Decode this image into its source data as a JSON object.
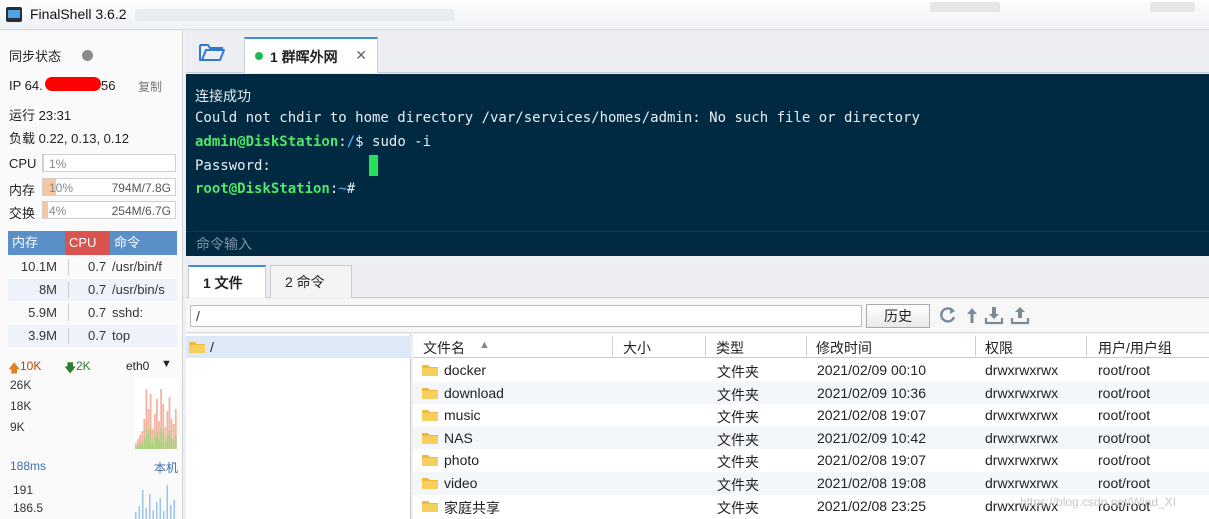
{
  "window": {
    "title": "FinalShell 3.6.2"
  },
  "left": {
    "sync_label": "同步状态",
    "ip_prefix": "IP 64.",
    "ip_suffix": "56",
    "copy_label": "复制",
    "uptime": "运行 23:31",
    "load": "负载 0.22, 0.13, 0.12",
    "cpu": {
      "label": "CPU",
      "pct": "1%",
      "fill": 1
    },
    "mem": {
      "label": "内存",
      "pct": "10%",
      "amount": "794M/7.8G",
      "fill": 10
    },
    "swap": {
      "label": "交换",
      "pct": "4%",
      "amount": "254M/6.7G",
      "fill": 4
    },
    "proc_headers": [
      "内存",
      "CPU",
      "命令"
    ],
    "processes": [
      {
        "mem": "10.1M",
        "cpu": "0.7",
        "cmd": "/usr/bin/f"
      },
      {
        "mem": "8M",
        "cpu": "0.7",
        "cmd": "/usr/bin/s"
      },
      {
        "mem": "5.9M",
        "cpu": "0.7",
        "cmd": "sshd:"
      },
      {
        "mem": "3.9M",
        "cpu": "0.7",
        "cmd": "top"
      }
    ],
    "net": {
      "up": "10K",
      "down": "2K",
      "iface": "eth0",
      "ticks": [
        "26K",
        "18K",
        "9K"
      ]
    },
    "ping": {
      "latency": "188ms",
      "target": "本机",
      "ticks": [
        "191",
        "186.5"
      ]
    }
  },
  "tabs": {
    "session": "1 群晖外网"
  },
  "terminal": {
    "line1": "连接成功",
    "line2": "Could not chdir to home directory /var/services/homes/admin: No such file or directory",
    "prompt1_user": "admin@DiskStation",
    "prompt1_sep": ":",
    "prompt1_path": "/",
    "prompt1_cmd": "$ sudo -i",
    "line4": "Password:",
    "prompt2_user": "root@DiskStation",
    "prompt2_sep": ":",
    "prompt2_path": "~",
    "prompt2_cmd": "#",
    "input_placeholder": "命令输入"
  },
  "bottom_tabs": {
    "files": "1 文件",
    "commands": "2 命令"
  },
  "path": {
    "value": "/",
    "history": "历史"
  },
  "tree": {
    "root": "/"
  },
  "files": {
    "headers": [
      "文件名",
      "大小",
      "类型",
      "修改时间",
      "权限",
      "用户/用户组"
    ],
    "rows": [
      {
        "name": "docker",
        "type": "文件夹",
        "mtime": "2021/02/09 00:10",
        "perm": "drwxrwxrwx",
        "owner": "root/root"
      },
      {
        "name": "download",
        "type": "文件夹",
        "mtime": "2021/02/09 10:36",
        "perm": "drwxrwxrwx",
        "owner": "root/root"
      },
      {
        "name": "music",
        "type": "文件夹",
        "mtime": "2021/02/08 19:07",
        "perm": "drwxrwxrwx",
        "owner": "root/root"
      },
      {
        "name": "NAS",
        "type": "文件夹",
        "mtime": "2021/02/09 10:42",
        "perm": "drwxrwxrwx",
        "owner": "root/root"
      },
      {
        "name": "photo",
        "type": "文件夹",
        "mtime": "2021/02/08 19:07",
        "perm": "drwxrwxrwx",
        "owner": "root/root"
      },
      {
        "name": "video",
        "type": "文件夹",
        "mtime": "2021/02/08 19:08",
        "perm": "drwxrwxrwx",
        "owner": "root/root"
      },
      {
        "name": "家庭共享",
        "type": "文件夹",
        "mtime": "2021/02/08 23:25",
        "perm": "drwxrwxrwx",
        "owner": "root/root"
      }
    ]
  },
  "colors": {
    "terminal_bg": "#002a42",
    "prompt_green": "#4ee86a",
    "accent_blue": "#3b8fdc",
    "cpu_red": "#d9534f"
  }
}
